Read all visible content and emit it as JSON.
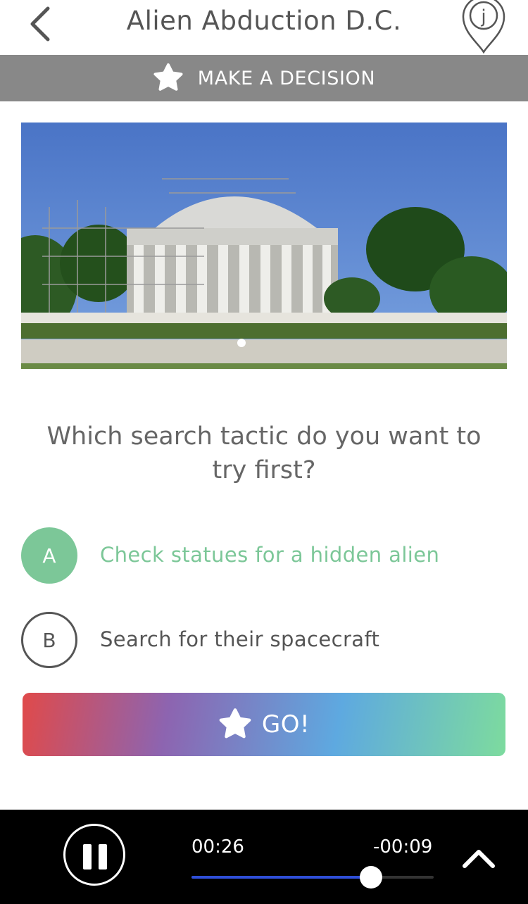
{
  "header": {
    "title": "Alien Abduction D.C.",
    "back_icon": "chevron-left-icon",
    "pin_icon": "location-pin-icon",
    "pin_letter": "j"
  },
  "decision_bar": {
    "label": "MAKE A DECISION",
    "icon": "star-icon"
  },
  "photo": {
    "carousel_dots": 1,
    "active_dot": 1
  },
  "question": {
    "text": "Which search tactic do you want to try first?"
  },
  "options": [
    {
      "letter": "A",
      "label": "Check statues for a hidden alien",
      "selected": true
    },
    {
      "letter": "B",
      "label": "Search for their spacecraft",
      "selected": false
    }
  ],
  "go_button": {
    "label": "GO!",
    "icon": "star-icon"
  },
  "player": {
    "elapsed": "00:26",
    "remaining": "-00:09",
    "progress_fraction": 0.74,
    "pause_icon": "pause-icon",
    "expand_icon": "chevron-up-icon"
  },
  "colors": {
    "accent_green": "#7cc798",
    "decision_bar_bg": "#888888",
    "progress_blue": "#2f4fd8",
    "gradient": [
      "#e04a4a",
      "#8d64b0",
      "#5ea9e0",
      "#7ddb9e"
    ]
  }
}
